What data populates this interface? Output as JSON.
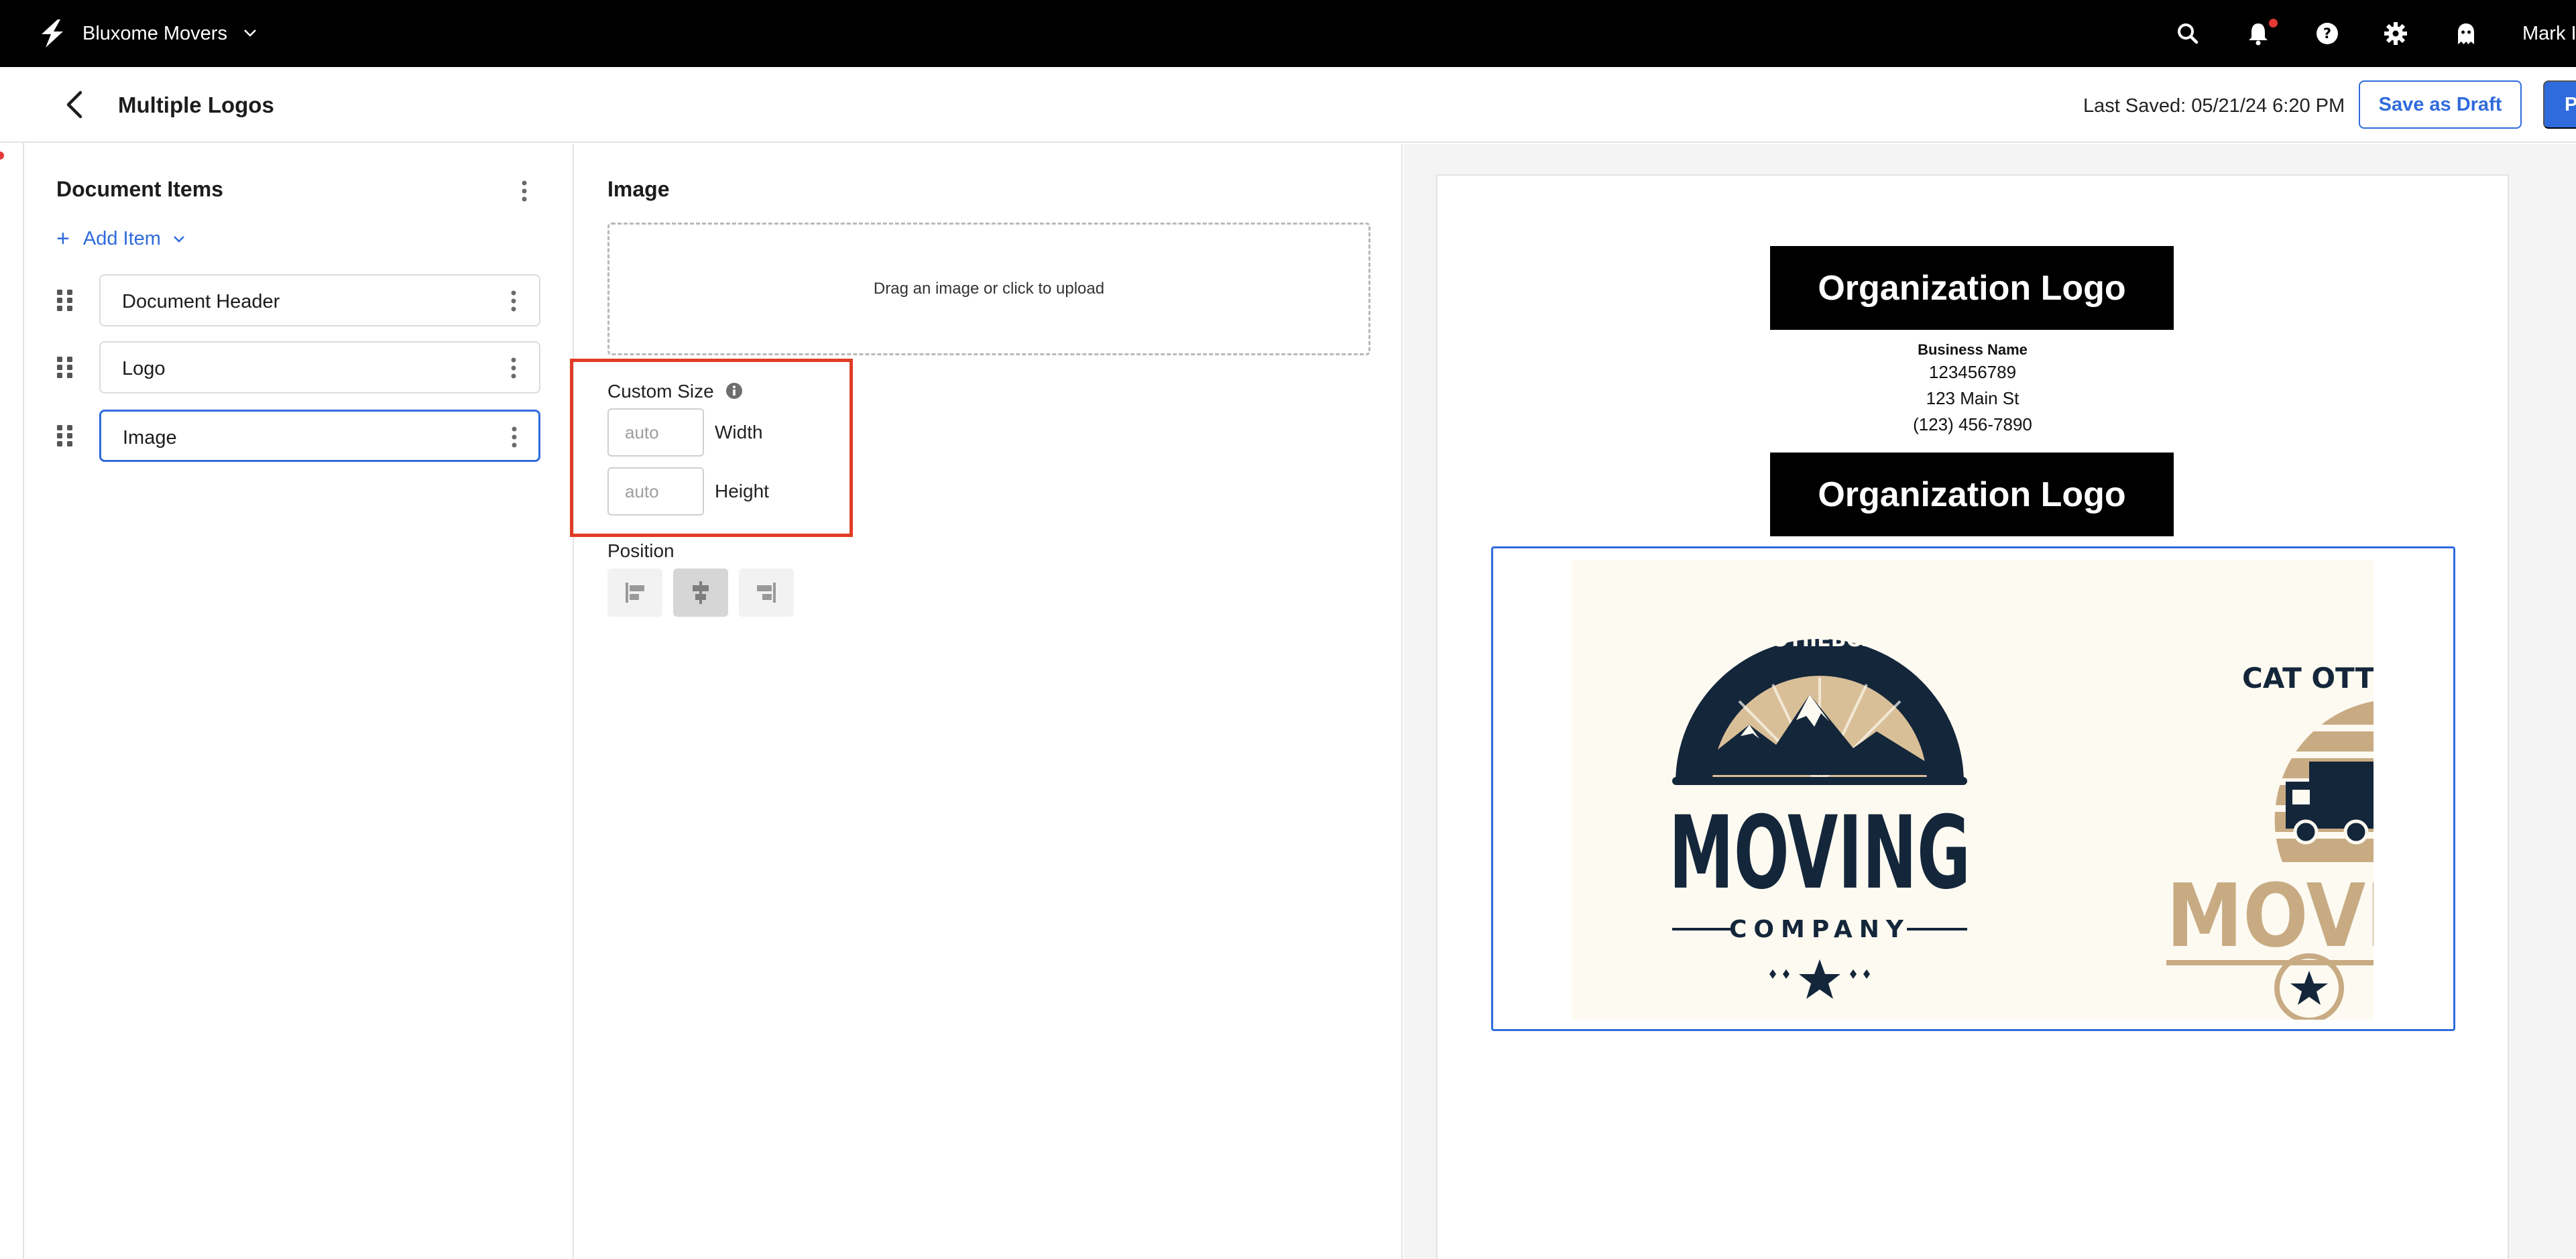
{
  "topbar": {
    "org_name": "Bluxome Movers",
    "user_name": "Mark I",
    "icons": [
      "bolt-logo-icon",
      "chevron-down-icon",
      "search-icon",
      "bell-icon",
      "help-icon",
      "gear-icon",
      "ghost-icon"
    ]
  },
  "subheader": {
    "title": "Multiple Logos",
    "last_saved": "Last Saved: 05/21/24 6:20 PM",
    "save_draft_label": "Save as Draft",
    "publish_label": "P"
  },
  "items_panel": {
    "heading": "Document Items",
    "add_item_label": "Add Item",
    "items": [
      {
        "label": "Document Header",
        "selected": false
      },
      {
        "label": "Logo",
        "selected": false
      },
      {
        "label": "Image",
        "selected": true
      }
    ]
  },
  "settings": {
    "heading": "Image",
    "upload_text": "Drag an image or click to upload",
    "custom_size_label": "Custom Size",
    "width": {
      "label": "Width",
      "placeholder": "auto",
      "value": ""
    },
    "height": {
      "label": "Height",
      "placeholder": "auto",
      "value": ""
    },
    "position_label": "Position",
    "position_options": [
      "left",
      "center",
      "right"
    ],
    "position_selected": "center"
  },
  "preview": {
    "org_logo_text": "Organization Logo",
    "business_name": "Business Name",
    "business_id": "123456789",
    "address": "123 Main St",
    "phone": "(123) 456-7890",
    "org_logo_text_2": "Organization Logo",
    "artwork": {
      "logo1_arc_text": "VE GOTIIEBOXEBE",
      "logo1_main": "MOVING",
      "logo1_sub": "COMPANY",
      "logo2_arc_text": "CAT OTTIW STS",
      "logo2_main": "MOVI",
      "colors": {
        "navy": "#14263a",
        "tan": "#c8ab83",
        "cream": "#fdfaf1"
      }
    }
  },
  "colors": {
    "accent": "#2f6bdc",
    "highlight": "#e03c25",
    "topbar": "#000000"
  }
}
